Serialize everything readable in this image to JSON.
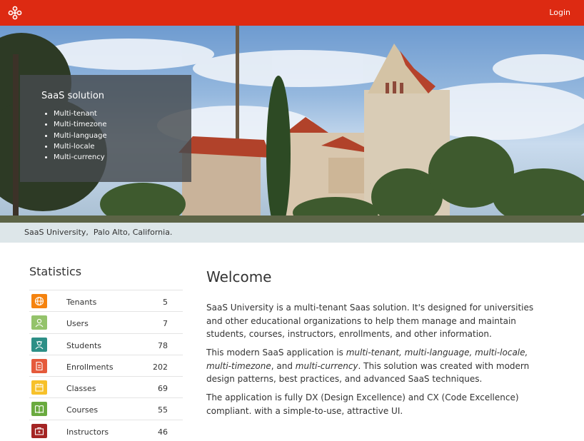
{
  "header": {
    "login_label": "Login",
    "brand_color": "#dd2a12"
  },
  "hero": {
    "panel_title": "SaaS solution",
    "features": [
      "Multi-tenant",
      "Multi-timezone",
      "Multi-language",
      "Multi-locale",
      "Multi-currency"
    ]
  },
  "caption": "SaaS University,  Palo Alto, California.",
  "stats": {
    "title": "Statistics",
    "items": [
      {
        "label": "Tenants",
        "value": "5",
        "color": "#f5830f",
        "icon": "globe-icon"
      },
      {
        "label": "Users",
        "value": "7",
        "color": "#94c36b",
        "icon": "user-icon"
      },
      {
        "label": "Students",
        "value": "78",
        "color": "#2d8f86",
        "icon": "student-icon"
      },
      {
        "label": "Enrollments",
        "value": "202",
        "color": "#e55a3c",
        "icon": "document-icon"
      },
      {
        "label": "Classes",
        "value": "69",
        "color": "#f7c12a",
        "icon": "calendar-icon"
      },
      {
        "label": "Courses",
        "value": "55",
        "color": "#6aaa3f",
        "icon": "book-icon"
      },
      {
        "label": "Instructors",
        "value": "46",
        "color": "#a42524",
        "icon": "briefcase-icon"
      }
    ]
  },
  "welcome": {
    "title": "Welcome",
    "p1": "SaaS University is a multi-tenant Saas solution. It's designed for universities and other educational organizations to help them manage and maintain students, courses, instructors, enrollments, and other information.",
    "p2_a": "This modern SaaS application is ",
    "p2_em1": "multi-tenant, multi-language, multi-locale, multi-timezone",
    "p2_b": ", and ",
    "p2_em2": "multi-currency",
    "p2_c": ". This solution was created with modern design patterns, best practices, and advanced SaaS techniques.",
    "p3": "The application is fully DX (Design Excellence) and CX (Code Excellence) compliant. with a simple-to-use, attractive UI."
  }
}
